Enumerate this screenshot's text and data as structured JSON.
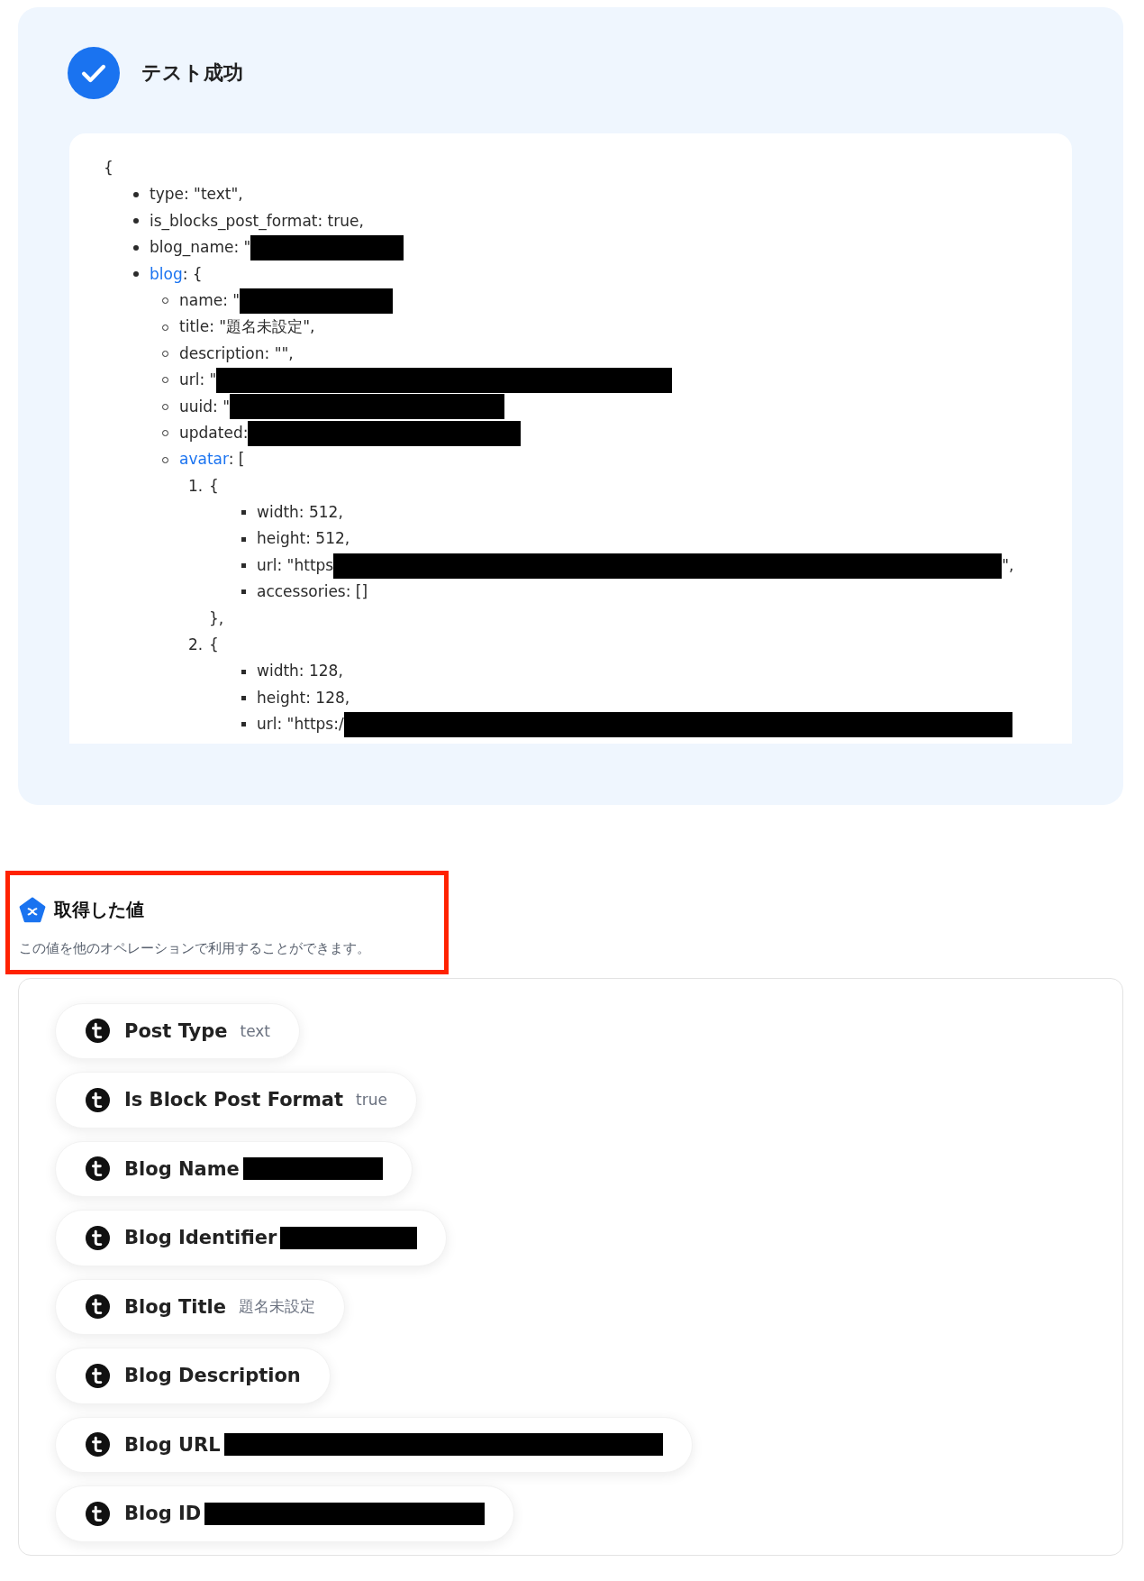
{
  "test_result": {
    "title": "テスト成功",
    "output": {
      "open": "{",
      "items": [
        {
          "text": "type: \"text\","
        },
        {
          "text": "is_blocks_post_format: true,"
        },
        {
          "text": "blog_name: \"",
          "redacted": true
        },
        {
          "link": "blog",
          "text": ": {",
          "children": [
            {
              "text": "name: \"",
              "redacted": true
            },
            {
              "text": "title: \"題名未設定\","
            },
            {
              "text": "description: \"\","
            },
            {
              "text": "url: \"",
              "redacted": true
            },
            {
              "text": "uuid: \"",
              "redacted": true
            },
            {
              "text": "updated:",
              "redacted": true
            },
            {
              "link": "avatar",
              "text": ": [",
              "entries": [
                {
                  "marker": "1.",
                  "open": "{",
                  "close": "},",
                  "children": [
                    {
                      "text": "width: 512,"
                    },
                    {
                      "text": "height: 512,"
                    },
                    {
                      "text": "url: \"https",
                      "redacted": true,
                      "suffix": "\","
                    },
                    {
                      "text": "accessories: []"
                    }
                  ]
                },
                {
                  "marker": "2.",
                  "open": "{",
                  "children": [
                    {
                      "text": "width: 128,"
                    },
                    {
                      "text": "height: 128,"
                    },
                    {
                      "text": "url: \"https:/",
                      "redacted": true
                    }
                  ]
                }
              ]
            }
          ]
        }
      ]
    }
  },
  "values_section": {
    "title": "取得した値",
    "description": "この値を他のオペレーションで利用することができます。",
    "highlighted": true
  },
  "values": [
    {
      "label": "Post Type",
      "value": "text"
    },
    {
      "label": "Is Block Post Format",
      "value": "true"
    },
    {
      "label": "Blog Name",
      "redacted": true
    },
    {
      "label": "Blog Identifier",
      "redacted": true
    },
    {
      "label": "Blog Title",
      "value": "題名未設定"
    },
    {
      "label": "Blog Description"
    },
    {
      "label": "Blog URL",
      "redacted": true
    },
    {
      "label": "Blog ID",
      "redacted": true
    }
  ]
}
